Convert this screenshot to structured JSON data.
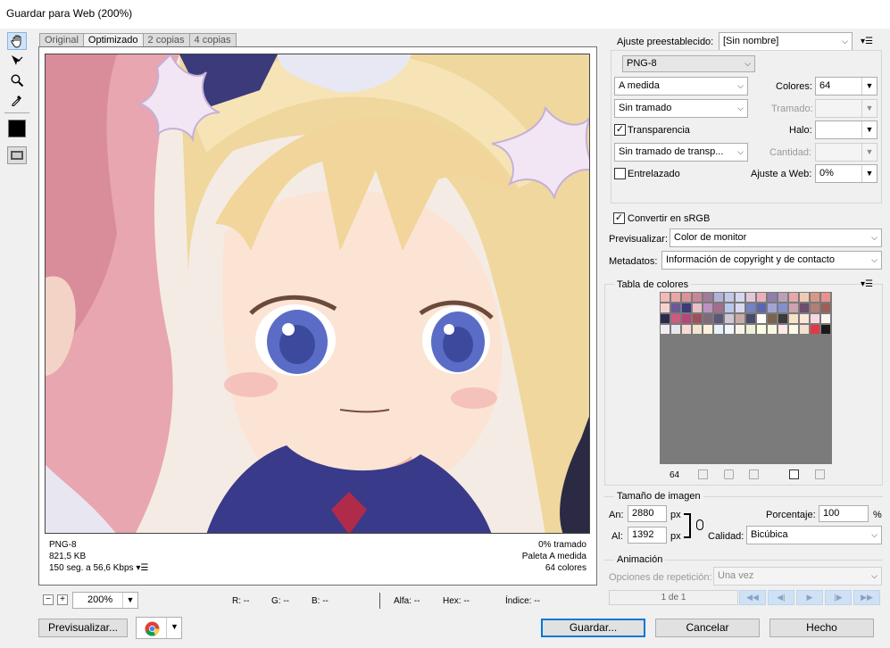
{
  "window": {
    "title": "Guardar para Web (200%)"
  },
  "tools": [
    {
      "name": "hand-tool-icon"
    },
    {
      "name": "slice-select-tool-icon"
    },
    {
      "name": "zoom-tool-icon"
    },
    {
      "name": "eyedropper-tool-icon"
    },
    {
      "name": "eyedropper-color-swatch"
    },
    {
      "name": "toggle-slices-visibility-icon"
    }
  ],
  "tabs": [
    "Original",
    "Optimizado",
    "2 copias",
    "4 copias"
  ],
  "active_tab": "Optimizado",
  "image_info": {
    "format": "PNG-8",
    "size": "821,5 KB",
    "download_time": "150 seg. a 56,6 Kbps",
    "dither": "0% tramado",
    "palette": "Paleta A medida",
    "colors": "64 colores"
  },
  "zoom": {
    "value": "200%",
    "minus": "−",
    "plus": "+"
  },
  "pixel_readout": {
    "r": "R: --",
    "g": "G: --",
    "b": "B: --",
    "alpha": "Alfa: --",
    "hex": "Hex: --",
    "index": "Índice: --"
  },
  "bottom_buttons": {
    "preview": "Previsualizar...",
    "save": "Guardar...",
    "cancel": "Cancelar",
    "done": "Hecho"
  },
  "settings": {
    "preset_label": "Ajuste preestablecido:",
    "preset_value": "[Sin nombre]",
    "format_value": "PNG-8",
    "palette_value": "A medida",
    "colors_label": "Colores:",
    "colors_value": "64",
    "dither_algo_value": "Sin tramado",
    "dither_label": "Tramado:",
    "transparency_label": "Transparencia",
    "matte_label": "Halo:",
    "transparency_dither_value": "Sin tramado de transp...",
    "amount_label": "Cantidad:",
    "interlaced_label": "Entrelazado",
    "websnap_label": "Ajuste a Web:",
    "websnap_value": "0%",
    "convert_srgb_label": "Convertir en sRGB",
    "preview_label": "Previsualizar:",
    "preview_value": "Color de monitor",
    "metadata_label": "Metadatos:",
    "metadata_value": "Información de copyright y de contacto"
  },
  "color_table": {
    "title": "Tabla de colores",
    "count": "64",
    "swatches": [
      "#f3b9b6",
      "#e8a7a6",
      "#d9939a",
      "#c88697",
      "#9f7c9c",
      "#b4b1d8",
      "#c4c8e8",
      "#d6d6ee",
      "#e0c8d8",
      "#e9b0b8",
      "#8d7faa",
      "#bba0b8",
      "#e3a8a8",
      "#f1cab6",
      "#d49a86",
      "#e7928e",
      "#f6d2cc",
      "#6a5a9a",
      "#3b3a7a",
      "#e8c0c8",
      "#bc92c4",
      "#a66c8e",
      "#b8c8e8",
      "#dad8f0",
      "#7682c2",
      "#5a66b0",
      "#a0a4d4",
      "#8490cc",
      "#cfa2b2",
      "#6c4e6e",
      "#b08078",
      "#9a6058",
      "#2a2a50",
      "#d05a7c",
      "#b8467a",
      "#a0505a",
      "#7e6a7a",
      "#5a5878",
      "#d2c6d6",
      "#caaaa8",
      "#4a4a6a",
      "#fffdf6",
      "#7a6450",
      "#3a3a3a",
      "#f8e2c8",
      "#fce6d8",
      "#f6d8e0",
      "#fbf4f0",
      "#f2ecf0",
      "#e6e6ec",
      "#fadad4",
      "#f2e4d0",
      "#fff0dc",
      "#e8f0f8",
      "#f0f8ff",
      "#f8f4e8",
      "#f0f0d8",
      "#fdfde4",
      "#f8f8e0",
      "#ffe8e8",
      "#fffae8",
      "#f4e0d0",
      "#e03a4a",
      "#1a1a1a"
    ]
  },
  "image_size": {
    "title": "Tamaño de imagen",
    "width_label": "An:",
    "width_value": "2880",
    "height_label": "Al:",
    "height_value": "1392",
    "unit": "px",
    "percent_label": "Porcentaje:",
    "percent_value": "100",
    "percent_unit": "%",
    "quality_label": "Calidad:",
    "quality_value": "Bicúbica"
  },
  "animation": {
    "title": "Animación",
    "loop_label": "Opciones de repetición:",
    "loop_value": "Una vez",
    "frame_counter": "1 de 1"
  }
}
